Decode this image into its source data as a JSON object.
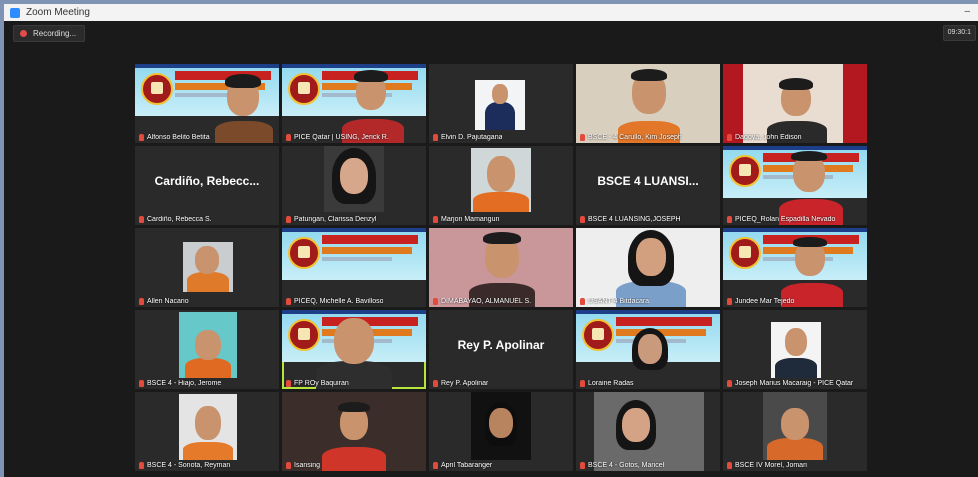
{
  "window": {
    "title": "Zoom Meeting"
  },
  "topbar": {
    "recording_label": "Recording...",
    "timer": "09:30:1"
  },
  "participants": [
    {
      "name": "Alfonso Belito Betita"
    },
    {
      "name": "PICE Qatar | USING, Jerick R."
    },
    {
      "name": "Elvin D. Pajutagana"
    },
    {
      "name": "BSCE - 4 Carullo, Kim Joseph"
    },
    {
      "name": "Dagoya, John Edison"
    },
    {
      "name": "Cardiño, Rebecca S.",
      "display": "Cardiño, Rebecc..."
    },
    {
      "name": "Patungan, Clarissa Denzyl"
    },
    {
      "name": "Marjon Mamangun"
    },
    {
      "name": "BSCE 4 LUANSING,JOSEPH",
      "display": "BSCE 4 LUANSI..."
    },
    {
      "name": "PICEQ_Rolan Espadilla Nevado"
    },
    {
      "name": "Allen Nacario"
    },
    {
      "name": "PICEQ, Michelle A. Bavilloso"
    },
    {
      "name": "DIMABAYAO, ALMANUEL S."
    },
    {
      "name": "USANT-4 Bitdacara"
    },
    {
      "name": "Jundee Mar Tejedo"
    },
    {
      "name": "BSCE 4 - Hiajo, Jerome"
    },
    {
      "name": "FP ROy Baquiran"
    },
    {
      "name": "Rey P. Apolinar",
      "display": "Rey P. Apolinar"
    },
    {
      "name": "Loraine Radas"
    },
    {
      "name": "Joseph Marius Macaraig - PICE Qatar"
    },
    {
      "name": "BSCE 4 - Sonota, Reyman"
    },
    {
      "name": "Isansing"
    },
    {
      "name": "April Tabaranger"
    },
    {
      "name": "BSCE 4 - Gotos, Maricel"
    },
    {
      "name": "BSCE IV Morel, Jomari"
    }
  ]
}
